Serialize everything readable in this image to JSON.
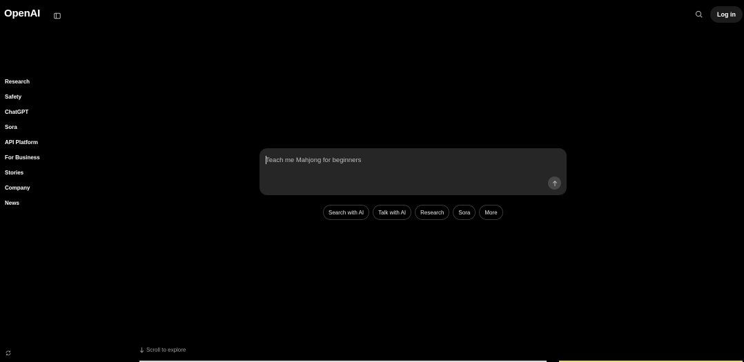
{
  "header": {
    "logo": "OpenAI",
    "login_label": "Log in",
    "icons": {
      "sidebar_toggle": "sidebar-toggle-icon",
      "search": "search-icon"
    }
  },
  "nav": {
    "items": [
      {
        "label": "Research"
      },
      {
        "label": "Safety"
      },
      {
        "label": "ChatGPT"
      },
      {
        "label": "Sora"
      },
      {
        "label": "API Platform"
      },
      {
        "label": "For Business"
      },
      {
        "label": "Stories"
      },
      {
        "label": "Company"
      },
      {
        "label": "News"
      }
    ]
  },
  "composer": {
    "placeholder": "Teach me Mahjong for beginners",
    "value": "",
    "send_icon": "arrow-up-icon"
  },
  "chips": [
    {
      "label": "Search with AI"
    },
    {
      "label": "Talk with AI"
    },
    {
      "label": "Research"
    },
    {
      "label": "Sora"
    },
    {
      "label": "More"
    }
  ],
  "footer": {
    "scroll_hint": "Scroll to explore",
    "refresh_icon": "refresh-icon"
  },
  "colors": {
    "background": "#000000",
    "composer_bg": "#262626",
    "chip_border": "#3a3a3a",
    "login_bg": "#1c1c1c"
  }
}
